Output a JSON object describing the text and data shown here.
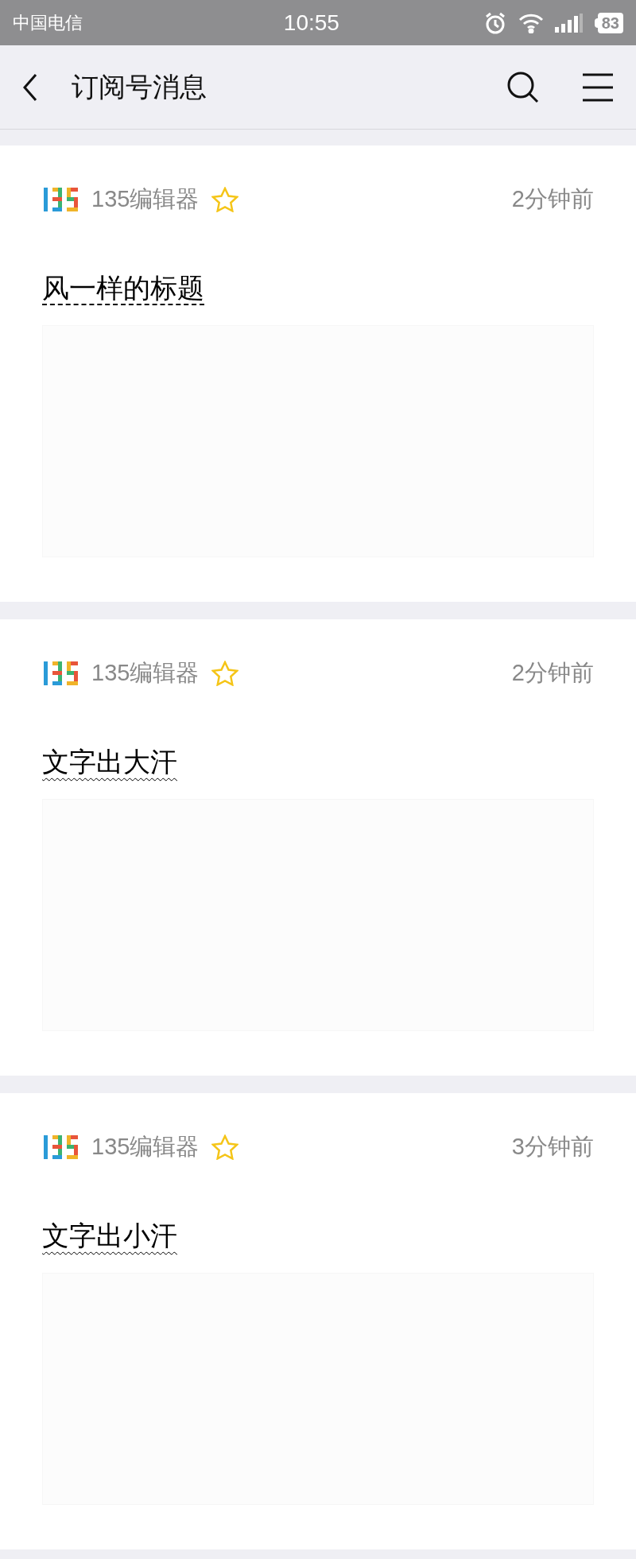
{
  "status_bar": {
    "carrier": "中国电信",
    "time": "10:55",
    "battery": "83"
  },
  "nav_bar": {
    "title": "订阅号消息"
  },
  "messages": [
    {
      "account": "135编辑器",
      "time": "2分钟前",
      "title": "风一样的标题",
      "kind": "lines"
    },
    {
      "account": "135编辑器",
      "time": "2分钟前",
      "title": "文字出大汗",
      "kind": "waves"
    },
    {
      "account": "135编辑器",
      "time": "3分钟前",
      "title": "文字出小汗",
      "kind": "waves"
    }
  ]
}
